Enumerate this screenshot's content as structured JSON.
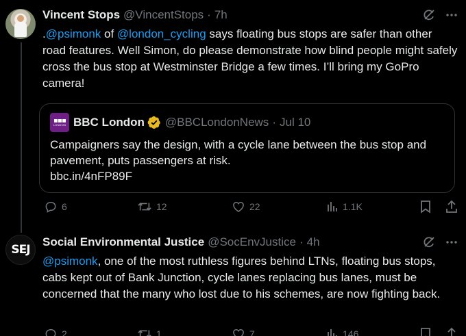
{
  "tweets": [
    {
      "name": "Vincent Stops",
      "handle": "@VincentStops",
      "separator": "·",
      "time": "7h",
      "text_parts": [
        {
          "type": "text",
          "value": "."
        },
        {
          "type": "mention",
          "value": "@psimonk"
        },
        {
          "type": "text",
          "value": " of "
        },
        {
          "type": "mention",
          "value": "@london_cycling"
        },
        {
          "type": "text",
          "value": " says floating bus stops are safer than other road features. Well Simon, do please demonstrate how blind people might safely cross the bus stop at Westminster Bridge a few times. I’ll bring my GoPro camera!"
        }
      ],
      "quote": {
        "name": "BBC London",
        "handle": "@BBCLondonNews",
        "separator": "·",
        "time": "Jul 10",
        "logo_text": "BBC",
        "logo_sub": "LONDON",
        "text": "Campaigners say the design, with a cycle lane between the bus stop and pavement, puts passengers at risk.",
        "link": "bbc.in/4nFP89F"
      },
      "stats": {
        "replies": "6",
        "reposts": "12",
        "likes": "22",
        "views": "1.1K"
      }
    },
    {
      "name": "Social Environmental Justice",
      "handle": "@SocEnvJustice",
      "separator": "·",
      "time": "4h",
      "avatar_text": "SEJ",
      "text_parts": [
        {
          "type": "mention",
          "value": "@psimonk"
        },
        {
          "type": "text",
          "value": ", one of the most ruthless figures behind LTNs, floating bus stops, cabs kept out of Bank Junction, cycle lanes replacing bus lanes, must be concerned that the many who lost due to his schemes, are now fighting back."
        }
      ],
      "stats": {
        "replies": "2",
        "reposts": "1",
        "likes": "7",
        "views": "146"
      }
    }
  ],
  "colors": {
    "background": "#000000",
    "text": "#e7e9ea",
    "muted": "#71767b",
    "link": "#1d9bf0",
    "border": "#2f3336",
    "verified": "#e8b923"
  },
  "icons": [
    "grok-icon",
    "more-icon",
    "reply-icon",
    "repost-icon",
    "like-icon",
    "views-icon",
    "bookmark-icon",
    "share-icon",
    "verified-badge-icon"
  ]
}
